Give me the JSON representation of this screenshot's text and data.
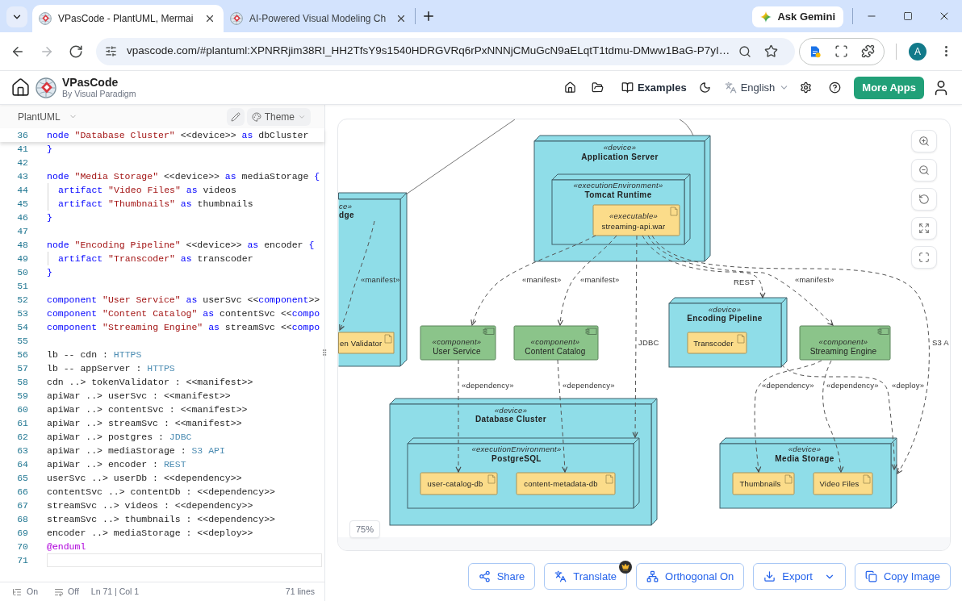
{
  "browser": {
    "tabs": [
      {
        "title": "VPasCode - PlantUML, Mermai",
        "selected": true
      },
      {
        "title": "AI-Powered Visual Modeling Ch",
        "selected": false
      }
    ],
    "gemini_button": "Ask Gemini",
    "nav_buttons": [
      {
        "kind": "back",
        "disabled": false
      },
      {
        "kind": "forward",
        "disabled": true
      },
      {
        "kind": "reload",
        "disabled": false
      }
    ],
    "url": "vpascode.com/#plantuml:XPNRRjim38RI_HH2TfsY9s1540HDRGVRq6rPxNNNjCMuGcN9aELqtT1tdmu-DMww1BaG-P7yI…",
    "profile_initial": "A"
  },
  "app": {
    "title": "VPasCode",
    "subtitle": "By Visual Paradigm",
    "examples_link": "Examples",
    "language": "English",
    "more_apps_button": "More Apps"
  },
  "editor": {
    "diagram_type": "PlantUML",
    "theme_button": "Theme",
    "sticky_line": {
      "number": "36",
      "tokens": [
        {
          "kind": "keyword",
          "text": "node"
        },
        {
          "kind": "string",
          "text": " \"Database Cluster\""
        },
        {
          "kind": "plain",
          "text": " <<device>>"
        },
        {
          "kind": "keyword",
          "text": " as"
        },
        {
          "kind": "plain",
          "text": " dbCluster"
        }
      ]
    },
    "lines": [
      {
        "number": "41",
        "current": false,
        "tokens": [
          {
            "kind": "keyword",
            "text": "}"
          }
        ]
      },
      {
        "number": "42",
        "current": false
      },
      {
        "number": "43",
        "current": false,
        "tokens": [
          {
            "kind": "keyword",
            "text": "node"
          },
          {
            "kind": "string",
            "text": " \"Media Storage\""
          },
          {
            "kind": "plain",
            "text": " <<device>>"
          },
          {
            "kind": "keyword",
            "text": " as"
          },
          {
            "kind": "plain",
            "text": " mediaStorage"
          },
          {
            "kind": "keyword",
            "text": " {"
          }
        ],
        "children": [
          {
            "number": "44",
            "current": false,
            "tokens": [
              {
                "kind": "keyword",
                "text": "artifact"
              },
              {
                "kind": "string",
                "text": " \"Video Files\""
              },
              {
                "kind": "keyword",
                "text": " as"
              },
              {
                "kind": "plain",
                "text": " videos"
              }
            ]
          },
          {
            "number": "45",
            "current": false,
            "tokens": [
              {
                "kind": "keyword",
                "text": "artifact"
              },
              {
                "kind": "string",
                "text": " \"Thumbnails\""
              },
              {
                "kind": "keyword",
                "text": " as"
              },
              {
                "kind": "plain",
                "text": " thumbnails"
              }
            ]
          }
        ]
      },
      {
        "number": "46",
        "current": false,
        "tokens": [
          {
            "kind": "keyword",
            "text": "}"
          }
        ]
      },
      {
        "number": "47",
        "current": false
      },
      {
        "number": "48",
        "current": false,
        "tokens": [
          {
            "kind": "keyword",
            "text": "node"
          },
          {
            "kind": "string",
            "text": " \"Encoding Pipeline\""
          },
          {
            "kind": "plain",
            "text": " <<device>>"
          },
          {
            "kind": "keyword",
            "text": " as"
          },
          {
            "kind": "plain",
            "text": " encoder"
          },
          {
            "kind": "keyword",
            "text": " {"
          }
        ],
        "children": [
          {
            "number": "49",
            "current": false,
            "tokens": [
              {
                "kind": "keyword",
                "text": "artifact"
              },
              {
                "kind": "string",
                "text": " \"Transcoder\""
              },
              {
                "kind": "keyword",
                "text": " as"
              },
              {
                "kind": "plain",
                "text": " transcoder"
              }
            ]
          }
        ]
      },
      {
        "number": "50",
        "current": false,
        "tokens": [
          {
            "kind": "keyword",
            "text": "}"
          }
        ]
      },
      {
        "number": "51",
        "current": false
      },
      {
        "number": "52",
        "current": false,
        "tokens": [
          {
            "kind": "keyword",
            "text": "component"
          },
          {
            "kind": "string",
            "text": " \"User Service\""
          },
          {
            "kind": "keyword",
            "text": " as"
          },
          {
            "kind": "plain",
            "text": " userSvc <<"
          },
          {
            "kind": "keyword",
            "text": "component"
          },
          {
            "kind": "plain",
            "text": ">>"
          }
        ]
      },
      {
        "number": "53",
        "current": false,
        "tokens": [
          {
            "kind": "keyword",
            "text": "component"
          },
          {
            "kind": "string",
            "text": " \"Content Catalog\""
          },
          {
            "kind": "keyword",
            "text": " as"
          },
          {
            "kind": "plain",
            "text": " contentSvc <<"
          },
          {
            "kind": "keyword",
            "text": "compo"
          }
        ]
      },
      {
        "number": "54",
        "current": false,
        "tokens": [
          {
            "kind": "keyword",
            "text": "component"
          },
          {
            "kind": "string",
            "text": " \"Streaming Engine\""
          },
          {
            "kind": "keyword",
            "text": " as"
          },
          {
            "kind": "plain",
            "text": " streamSvc <<"
          },
          {
            "kind": "keyword",
            "text": "compo"
          }
        ]
      },
      {
        "number": "55",
        "current": false
      },
      {
        "number": "56",
        "current": false,
        "tokens": [
          {
            "kind": "plain",
            "text": "lb -- cdn :"
          },
          {
            "kind": "label",
            "text": " HTTPS"
          }
        ]
      },
      {
        "number": "57",
        "current": false,
        "tokens": [
          {
            "kind": "plain",
            "text": "lb -- appServer :"
          },
          {
            "kind": "label",
            "text": " HTTPS"
          }
        ]
      },
      {
        "number": "58",
        "current": false,
        "tokens": [
          {
            "kind": "plain",
            "text": "cdn ..> tokenValidator : <<manifest>>"
          }
        ]
      },
      {
        "number": "59",
        "current": false,
        "tokens": [
          {
            "kind": "plain",
            "text": "apiWar ..> userSvc : <<manifest>>"
          }
        ]
      },
      {
        "number": "60",
        "current": false,
        "tokens": [
          {
            "kind": "plain",
            "text": "apiWar ..> contentSvc : <<manifest>>"
          }
        ]
      },
      {
        "number": "61",
        "current": false,
        "tokens": [
          {
            "kind": "plain",
            "text": "apiWar ..> streamSvc : <<manifest>>"
          }
        ]
      },
      {
        "number": "62",
        "current": false,
        "tokens": [
          {
            "kind": "plain",
            "text": "apiWar ..> postgres :"
          },
          {
            "kind": "label",
            "text": " JDBC"
          }
        ]
      },
      {
        "number": "63",
        "current": false,
        "tokens": [
          {
            "kind": "plain",
            "text": "apiWar ..> mediaStorage :"
          },
          {
            "kind": "label",
            "text": " S3 API"
          }
        ]
      },
      {
        "number": "64",
        "current": false,
        "tokens": [
          {
            "kind": "plain",
            "text": "apiWar ..> encoder :"
          },
          {
            "kind": "label",
            "text": " REST"
          }
        ]
      },
      {
        "number": "65",
        "current": false,
        "tokens": [
          {
            "kind": "plain",
            "text": "userSvc ..> userDb : <<dependency>>"
          }
        ]
      },
      {
        "number": "66",
        "current": false,
        "tokens": [
          {
            "kind": "plain",
            "text": "contentSvc ..> contentDb : <<dependency>>"
          }
        ]
      },
      {
        "number": "67",
        "current": false,
        "tokens": [
          {
            "kind": "plain",
            "text": "streamSvc ..> videos : <<dependency>>"
          }
        ]
      },
      {
        "number": "68",
        "current": false,
        "tokens": [
          {
            "kind": "plain",
            "text": "streamSvc ..> thumbnails : <<dependency>>"
          }
        ]
      },
      {
        "number": "69",
        "current": false,
        "tokens": [
          {
            "kind": "plain",
            "text": "encoder ..> mediaStorage : <<deploy>>"
          }
        ]
      },
      {
        "number": "70",
        "current": false,
        "tokens": [
          {
            "kind": "directive",
            "text": "@enduml"
          }
        ]
      },
      {
        "number": "71",
        "current": true
      }
    ],
    "status_bar": {
      "outline": "On",
      "word_wrap": "Off",
      "cursor": "Ln 71 | Col 1",
      "line_count": "71 lines"
    }
  },
  "diagram": {
    "nodes": [
      {
        "kind": "device",
        "stereotype": "ce»",
        "name": "dge",
        "children": [
          {
            "kind": "artifact",
            "name": "en Validator"
          }
        ]
      },
      {
        "kind": "device",
        "stereotype": "«device»",
        "name": "Application Server",
        "children": [
          {
            "kind": "environment",
            "stereotype": "«executionEnvironment»",
            "name": "Tomcat Runtime",
            "children": [
              {
                "kind": "artifact",
                "stereotype": "«executable»",
                "name": "streaming-api.war"
              }
            ]
          }
        ]
      },
      {
        "kind": "component",
        "stereotype": "«component»",
        "name": "User Service"
      },
      {
        "kind": "component",
        "stereotype": "«component»",
        "name": "Content Catalog"
      },
      {
        "kind": "device",
        "stereotype": "«device»",
        "name": "Encoding Pipeline",
        "children": [
          {
            "kind": "artifact",
            "name": "Transcoder"
          }
        ]
      },
      {
        "kind": "component",
        "stereotype": "«component»",
        "name": "Streaming Engine"
      },
      {
        "kind": "device",
        "stereotype": "«device»",
        "name": "Database Cluster",
        "children": [
          {
            "kind": "environment",
            "stereotype": "«executionEnvironment»",
            "name": "PostgreSQL",
            "children": [
              {
                "kind": "artifact",
                "name": "user-catalog-db"
              },
              {
                "kind": "artifact",
                "name": "content-metadata-db"
              }
            ]
          }
        ]
      },
      {
        "kind": "device",
        "stereotype": "«device»",
        "name": "Media Storage",
        "children": [
          {
            "kind": "artifact",
            "name": "Thumbnails"
          },
          {
            "kind": "artifact",
            "name": "Video Files"
          }
        ]
      }
    ],
    "edges": [
      {
        "kind": "association"
      },
      {
        "kind": "association"
      },
      {
        "kind": "dependency",
        "label": "«manifest»"
      },
      {
        "kind": "dependency",
        "label": "«manifest»"
      },
      {
        "kind": "dependency",
        "label": "«manifest»"
      },
      {
        "kind": "dependency",
        "label": "JDBC"
      },
      {
        "kind": "dependency",
        "label": "REST"
      },
      {
        "kind": "dependency",
        "label": "«manifest»"
      },
      {
        "kind": "dependency",
        "label": "S3 A"
      },
      {
        "kind": "dependency",
        "label": "«dependency»"
      },
      {
        "kind": "dependency",
        "label": "«dependency»"
      },
      {
        "kind": "dependency",
        "label": "«dependency»"
      },
      {
        "kind": "dependency",
        "label": "«dependency»"
      },
      {
        "kind": "dependency",
        "label": "«deploy»"
      }
    ],
    "zoom_level": "75%"
  },
  "actions": [
    {
      "kind": "share",
      "label": "Share",
      "premium": false,
      "menu": false
    },
    {
      "kind": "translate",
      "label": "Translate",
      "premium": true,
      "menu": false
    },
    {
      "kind": "layout",
      "label": "Orthogonal On",
      "premium": false,
      "menu": false
    },
    {
      "kind": "export",
      "label": "Export",
      "premium": false,
      "menu": true
    },
    {
      "kind": "copy",
      "label": "Copy Image",
      "premium": false,
      "menu": false
    }
  ]
}
